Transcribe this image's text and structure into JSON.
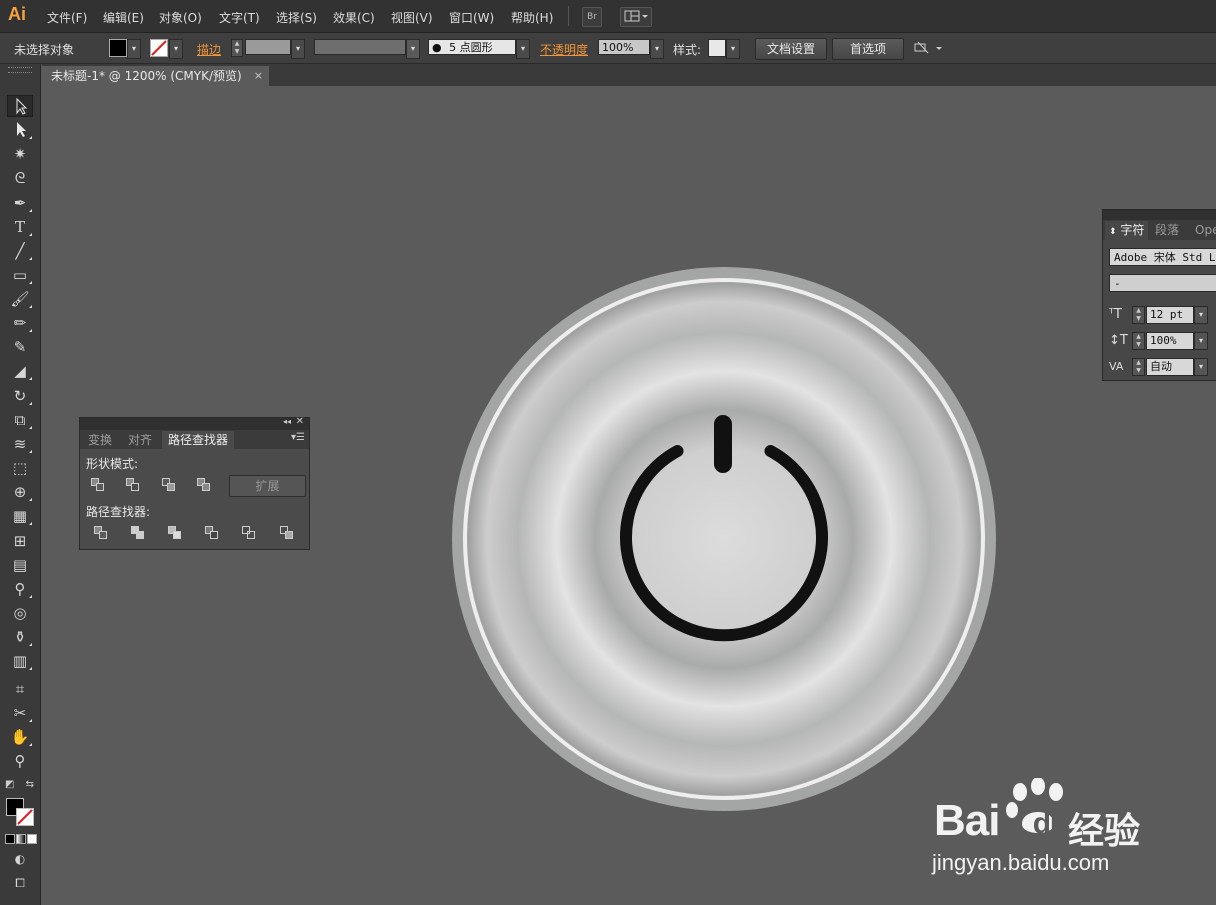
{
  "app": {
    "logo": "Ai"
  },
  "menu": {
    "items": [
      "文件(F)",
      "编辑(E)",
      "对象(O)",
      "文字(T)",
      "选择(S)",
      "效果(C)",
      "视图(V)",
      "窗口(W)",
      "帮助(H)"
    ],
    "bridge_label": "Br"
  },
  "control_bar": {
    "selection_status": "未选择对象",
    "stroke_label": "描边",
    "brush_value": "5 点圆形",
    "opacity_label": "不透明度",
    "opacity_value": "100%",
    "style_label": "样式:",
    "doc_setup_button": "文档设置",
    "preferences_button": "首选项"
  },
  "document": {
    "tab_title": "未标题-1* @ 1200% (CMYK/预览)",
    "close": "×"
  },
  "pathfinder_panel": {
    "tabs": [
      "变换",
      "对齐",
      "路径查找器"
    ],
    "active_tab": "路径查找器",
    "shape_modes_label": "形状模式:",
    "pathfinders_label": "路径查找器:",
    "expand_button": "扩展"
  },
  "character_panel": {
    "tabs": [
      "字符",
      "段落",
      "Ope"
    ],
    "font_family": "Adobe 宋体 Std L",
    "font_style": "-",
    "font_size": "12 pt",
    "leading": "100%",
    "tracking": "自动"
  },
  "watermark": {
    "brand": "Bai",
    "brand_du": "du",
    "brand_cn": "经验",
    "url": "jingyan.baidu.com"
  },
  "colors": {
    "accent": "#f7a23b",
    "canvas": "#5b5b5b",
    "panel": "#3a3a3a",
    "power_icon": "#111111"
  }
}
